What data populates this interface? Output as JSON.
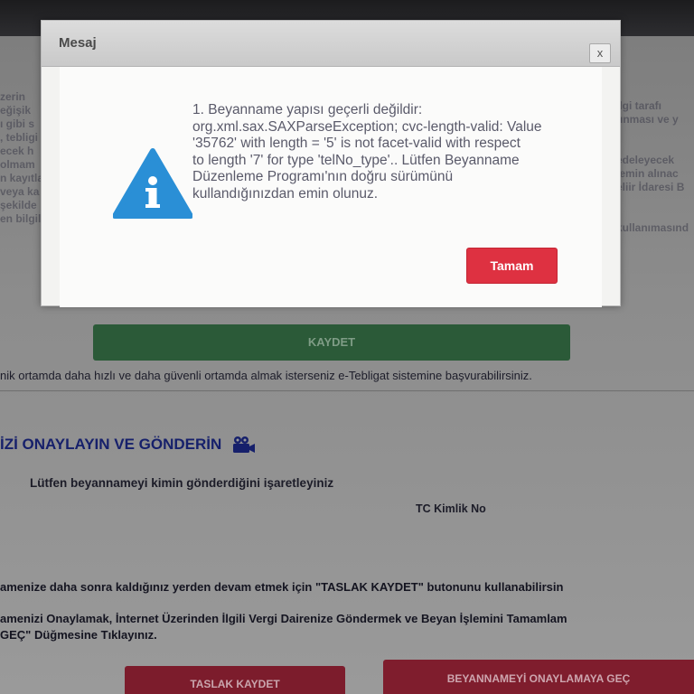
{
  "background": {
    "left_fragments": "zerin\neğişik\nı gibi s\n, tebligi\necek h\nolmam\nn kayıtla\nveya ka\nşekilde\nen bilgile",
    "right_fragments": "ilgi tarafı\ntınması ve y\n\n\nedeleyecek\nlemin alınac\neliir İdaresi B\n\n\nkullanımasınd",
    "save_button": "KAYDET",
    "etebligat_text": "nik ortamda daha hızlı ve daha güvenli ortamda almak isterseniz e-Tebligat sistemine başvurabilirsiniz.",
    "section_title": "İZİ ONAYLAYIN VE GÖNDERİN",
    "who_label": "Lütfen beyannameyi kimin gönderdiğini işaretleyiniz",
    "tc_label": "TC Kimlik No",
    "draft_info": "amenize daha sonra kaldığınız yerden devam etmek için \"TASLAK KAYDET\" butonunu kullanabilirsin",
    "approve_info": "amenizi Onaylamak, İnternet Üzerinden İlgili Vergi Dairenize Göndermek ve Beyan İşlemini Tamamlam\nGEÇ\" Düğmesine Tıklayınız.",
    "draft_button": "TASLAK KAYDET",
    "next_button": "BEYANNAMEYİ ONAYLAMAYA GEÇ"
  },
  "dialog": {
    "title": "Mesaj",
    "close_label": "x",
    "icon": "info-warning-icon",
    "icon_color": "#2a8fd6",
    "message": "1. Beyanname yapısı geçerli değildir:\norg.xml.sax.SAXParseException; cvc-length-valid: Value\n'35762' with length = '5' is not facet-valid with respect\nto length '7' for type 'telNo_type'.. Lütfen Beyanname\nDüzenleme Programı'nın doğru sürümünü\nkullandığınızdan emin olunuz.",
    "ok_button": "Tamam",
    "ok_color": "#de3141"
  }
}
